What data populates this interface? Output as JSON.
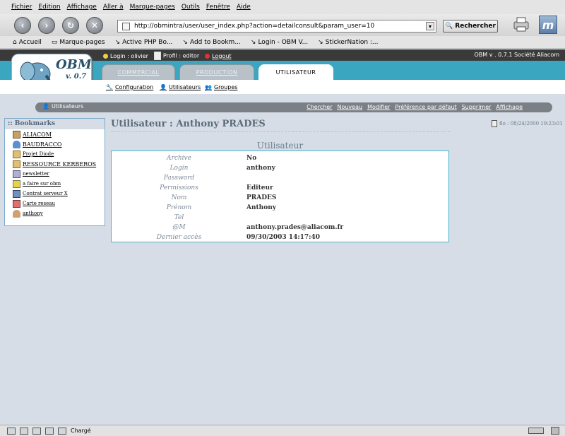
{
  "browser": {
    "menu": [
      "Fichier",
      "Edition",
      "Affichage",
      "Aller à",
      "Marque-pages",
      "Outils",
      "Fenêtre",
      "Aide"
    ],
    "url": "http://obmintra/user/user_index.php?action=detailconsult&param_user=10",
    "search_label": "Rechercher",
    "bookmarks": [
      "Accueil",
      "Marque-pages",
      "Active PHP Bo...",
      "Add to Bookm...",
      "Login - OBM V...",
      "StickerNation :..."
    ],
    "status": "Chargé"
  },
  "obm": {
    "login": "Login : olivier",
    "profile": "Profil : editor",
    "logout": "Logout",
    "version_company": "OBM v . 0.7.1   Société Aliacom",
    "logo_text": "OBM",
    "logo_version": "v. 0.7",
    "tabs": [
      "COMMERCIAL",
      "PRODUCTION",
      "UTILISATEUR"
    ],
    "subnav": [
      "Configuration",
      "Utilisateurs",
      "Groupes"
    ],
    "path_title": "Utilisateurs",
    "actions": [
      "Chercher",
      "Nouveau",
      "Modifier",
      "Préférence par défaut",
      "Supprimer",
      "Affichage"
    ]
  },
  "bookmarks_panel": {
    "title": ":: Bookmarks",
    "items": [
      "ALIACOM",
      "BAUDRACCO",
      "Projet Diode",
      "RESSOURCE KERBEROS",
      "newsletter",
      "a faire sur obm",
      "Contrat serveur X",
      "Carte reseau",
      "anthony"
    ]
  },
  "user": {
    "page_title": "Utilisateur : Anthony PRADES",
    "stamp": "flo : 08/24/2000 19:23:01",
    "section_title": "Utilisateur",
    "fields": [
      {
        "label": "Archive",
        "value": "No"
      },
      {
        "label": "Login",
        "value": "anthony"
      },
      {
        "label": "Password",
        "value": ""
      },
      {
        "label": "Permissions",
        "value": "Editeur"
      },
      {
        "label": "Nom",
        "value": "PRADES"
      },
      {
        "label": "Prénom",
        "value": "Anthony"
      },
      {
        "label": "Tel",
        "value": ""
      },
      {
        "label": "@M",
        "value": "anthony.prades@aliacom.fr"
      },
      {
        "label": "Dernier accès",
        "value": "09/30/2003 14:17:40"
      }
    ]
  },
  "colors": {
    "header_bar": "#3aa6c0",
    "page_bg": "#d6dde6",
    "title_text": "#5a6c7a"
  }
}
